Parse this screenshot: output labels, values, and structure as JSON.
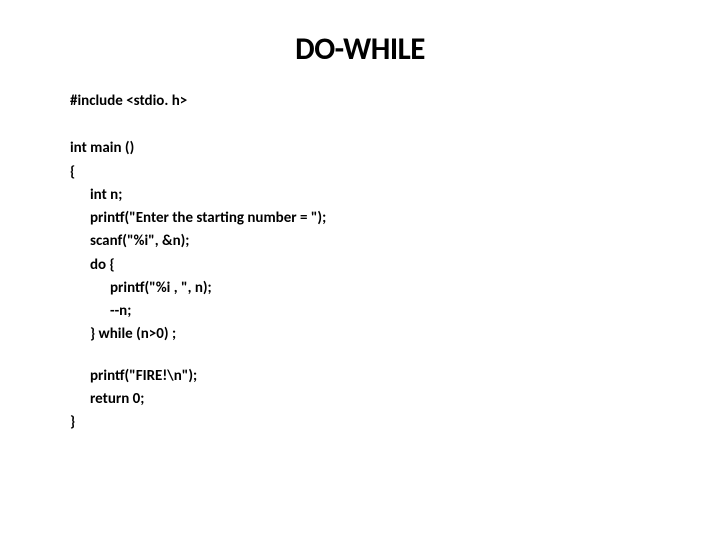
{
  "slide": {
    "title": "DO-WHILE",
    "code": {
      "line1": "#include <stdio. h>",
      "line2": "int main ()",
      "line3": "{",
      "line4": "int n;",
      "line5": "printf(\"Enter the starting number = \");",
      "line6": "scanf(\"%i\", &n);",
      "line7": "do {",
      "line8": "printf(\"%i , \", n);",
      "line9": "--n;",
      "line10": "} while (n>0) ;",
      "line11": "printf(\"FIRE!\\n\");",
      "line12": "return 0;",
      "line13": "}"
    }
  }
}
